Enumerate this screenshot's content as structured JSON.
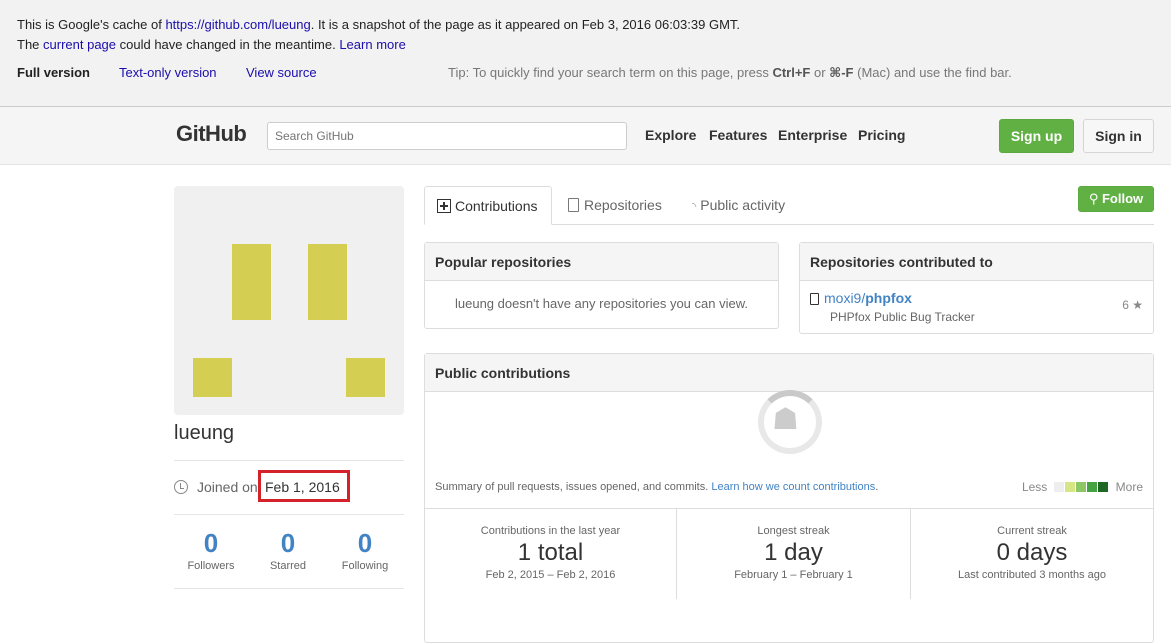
{
  "cache_banner": {
    "line1_prefix": "This is Google's cache of ",
    "cached_url": "https://github.com/lueung",
    "line1_suffix": ". It is a snapshot of the page as it appeared on Feb 3, 2016 06:03:39 GMT.",
    "line2_prefix": "The ",
    "current_page": "current page",
    "line2_mid": " could have changed in the meantime. ",
    "learn_more": "Learn more",
    "full_version": "Full version",
    "text_only": "Text-only version",
    "view_source": "View source",
    "tip_prefix": "Tip: To quickly find your search term on this page, press ",
    "tip_key1": "Ctrl+F",
    "tip_or": " or ",
    "tip_key2": "⌘-F",
    "tip_suffix": " (Mac) and use the find bar."
  },
  "header": {
    "logo": "GitHub",
    "search_placeholder": "Search GitHub",
    "nav": [
      "Explore",
      "Features",
      "Enterprise",
      "Pricing"
    ],
    "signup": "Sign up",
    "signin": "Sign in"
  },
  "profile": {
    "username": "lueung",
    "joined_prefix": "Joined on",
    "joined_date": "Feb 1, 2016",
    "stats": [
      {
        "value": "0",
        "label": "Followers"
      },
      {
        "value": "0",
        "label": "Starred"
      },
      {
        "value": "0",
        "label": "Following"
      }
    ],
    "avatar_color": "#d4cf52"
  },
  "tabs": {
    "contributions": "Contributions",
    "repositories": "Repositories",
    "public_activity": "Public activity",
    "follow": "Follow"
  },
  "popular_repos": {
    "title": "Popular repositories",
    "empty": "lueung doesn't have any repositories you can view."
  },
  "contributed_to": {
    "title": "Repositories contributed to",
    "owner": "moxi9",
    "separator": "/",
    "repo": "phpfox",
    "description": "PHPfox Public Bug Tracker",
    "stars": "6"
  },
  "public_contributions": {
    "title": "Public contributions",
    "summary": "Summary of pull requests, issues opened, and commits. ",
    "learn_link": "Learn how we count contributions",
    "summary_end": ".",
    "legend_less": "Less",
    "legend_more": "More",
    "legend_colors": [
      "#eeeeee",
      "#d6e685",
      "#8cc665",
      "#44a340",
      "#1e6823"
    ],
    "stats": [
      {
        "title": "Contributions in the last year",
        "value": "1 total",
        "sub": "Feb 2, 2015 – Feb 2, 2016"
      },
      {
        "title": "Longest streak",
        "value": "1 day",
        "sub": "February 1 – February 1"
      },
      {
        "title": "Current streak",
        "value": "0 days",
        "sub": "Last contributed 3 months ago"
      }
    ]
  }
}
